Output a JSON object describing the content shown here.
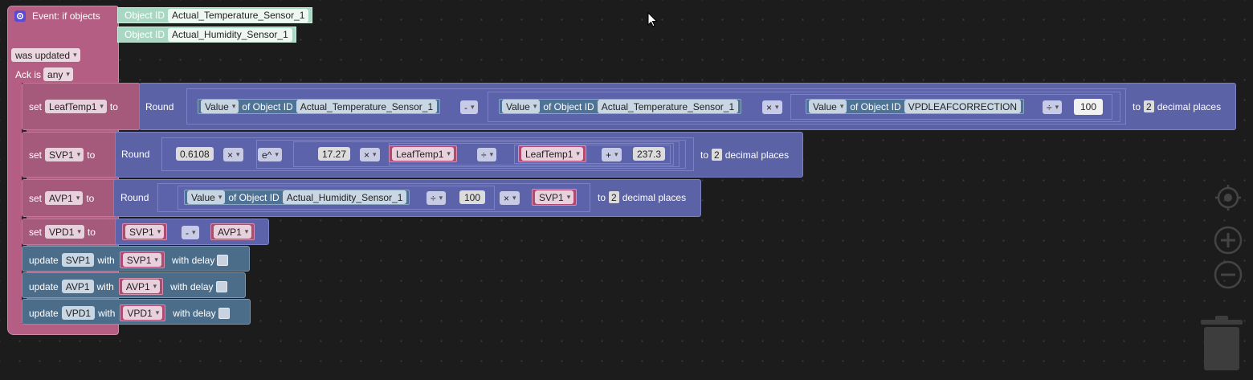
{
  "event": {
    "title": "Event: if objects",
    "object_id_label": "Object ID",
    "object_ids": [
      "Actual_Temperature_Sensor_1",
      "Actual_Humidity_Sensor_1"
    ],
    "trigger": "was updated",
    "ack_label": "Ack is",
    "ack_value": "any"
  },
  "common": {
    "set": "set",
    "to": "to",
    "round": "Round",
    "to_prefix": "to",
    "decimal_places": "decimal places",
    "decimals": "2",
    "value": "Value",
    "of_object_id": "of Object ID",
    "update": "update",
    "with": "with",
    "with_delay": "with delay"
  },
  "leaftemp": {
    "var": "LeafTemp1",
    "op1": "-",
    "op2": "×",
    "op3": "÷",
    "obj1": "Actual_Temperature_Sensor_1",
    "obj2": "Actual_Temperature_Sensor_1",
    "obj3": "VPDLEAFCORRECTION",
    "num": "100"
  },
  "svp": {
    "var": "SVP1",
    "n1": "0.6108",
    "op_mul": "×",
    "func": "e^",
    "n2": "17.27",
    "op_mul2": "×",
    "ref1": "LeafTemp1",
    "op_div": "÷",
    "ref2": "LeafTemp1",
    "op_add": "+",
    "n3": "237.3"
  },
  "avp": {
    "var": "AVP1",
    "obj": "Actual_Humidity_Sensor_1",
    "op_div": "÷",
    "num": "100",
    "op_mul": "×",
    "ref": "SVP1"
  },
  "vpd": {
    "var": "VPD1",
    "ref1": "SVP1",
    "op": "-",
    "ref2": "AVP1"
  },
  "updates": [
    {
      "target": "SVP1",
      "source": "SVP1"
    },
    {
      "target": "AVP1",
      "source": "AVP1"
    },
    {
      "target": "VPD1",
      "source": "VPD1"
    }
  ],
  "colors": {
    "event": "#b35e82",
    "variables": "#a65a7b",
    "math": "#5b62a6",
    "iobroker": "#4c6d8a",
    "object_shadow": "#a8d8c3"
  },
  "controls": {
    "center_icon": "target-icon",
    "zoom_in_icon": "zoom-in-icon",
    "zoom_out_icon": "zoom-out-icon",
    "trash_icon": "trash-icon"
  }
}
